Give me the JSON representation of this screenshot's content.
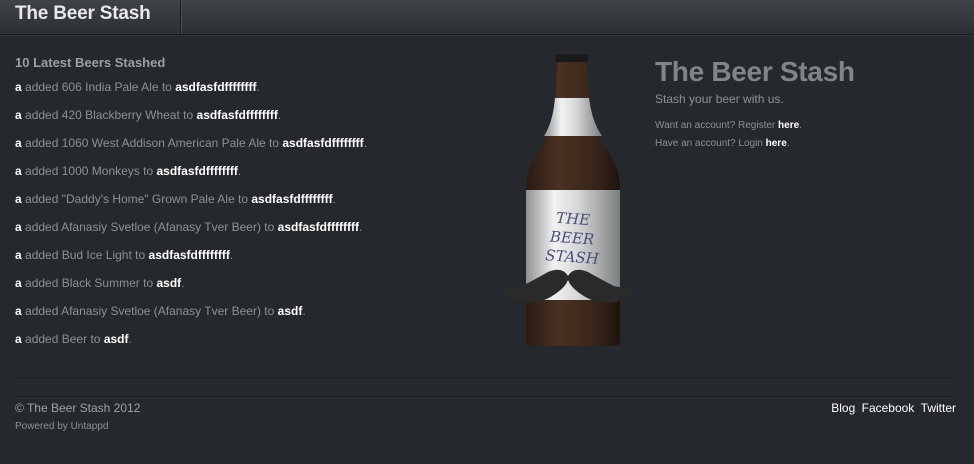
{
  "header": {
    "brand": "The Beer Stash"
  },
  "latest": {
    "title": "10 Latest Beers Stashed",
    "items": [
      {
        "user": "a",
        "verb": "added",
        "beer": "606 India Pale Ale",
        "to": "to",
        "stash": "asdfasfdffffffff"
      },
      {
        "user": "a",
        "verb": "added",
        "beer": "420 Blackberry Wheat",
        "to": "to",
        "stash": "asdfasfdffffffff"
      },
      {
        "user": "a",
        "verb": "added",
        "beer": "1060 West Addison American Pale Ale",
        "to": "to",
        "stash": "asdfasfdffffffff"
      },
      {
        "user": "a",
        "verb": "added",
        "beer": "1000 Monkeys",
        "to": "to",
        "stash": "asdfasfdffffffff"
      },
      {
        "user": "a",
        "verb": "added",
        "beer": "\"Daddy's Home\" Grown Pale Ale",
        "to": "to",
        "stash": "asdfasfdffffffff"
      },
      {
        "user": "a",
        "verb": "added",
        "beer": "Afanasiy Svetloe (Afanasy Tver Beer)",
        "to": "to",
        "stash": "asdfasfdffffffff"
      },
      {
        "user": "a",
        "verb": "added",
        "beer": "Bud Ice Light",
        "to": "to",
        "stash": "asdfasfdffffffff"
      },
      {
        "user": "a",
        "verb": "added",
        "beer": "Black Summer",
        "to": "to",
        "stash": "asdf"
      },
      {
        "user": "a",
        "verb": "added",
        "beer": "Afanasiy Svetloe (Afanasy Tver Beer)",
        "to": "to",
        "stash": "asdf"
      },
      {
        "user": "a",
        "verb": "added",
        "beer": "Beer",
        "to": "to",
        "stash": "asdf"
      }
    ]
  },
  "bottle_label": [
    "THE",
    "BEER",
    "STASH"
  ],
  "hero": {
    "title": "The Beer Stash",
    "tagline": "Stash your beer with us.",
    "register_text": "Want an account? Register",
    "register_link": "here",
    "login_text": "Have an account? Login",
    "login_link": "here"
  },
  "footer": {
    "copyright": "© The Beer Stash 2012",
    "powered": "Powered by Untappd",
    "links": [
      "Blog",
      "Facebook",
      "Twitter"
    ]
  },
  "colors": {
    "background": "#25282c",
    "text": "#8d9196",
    "link": "#ffffff",
    "hero_title": "#80858a"
  }
}
